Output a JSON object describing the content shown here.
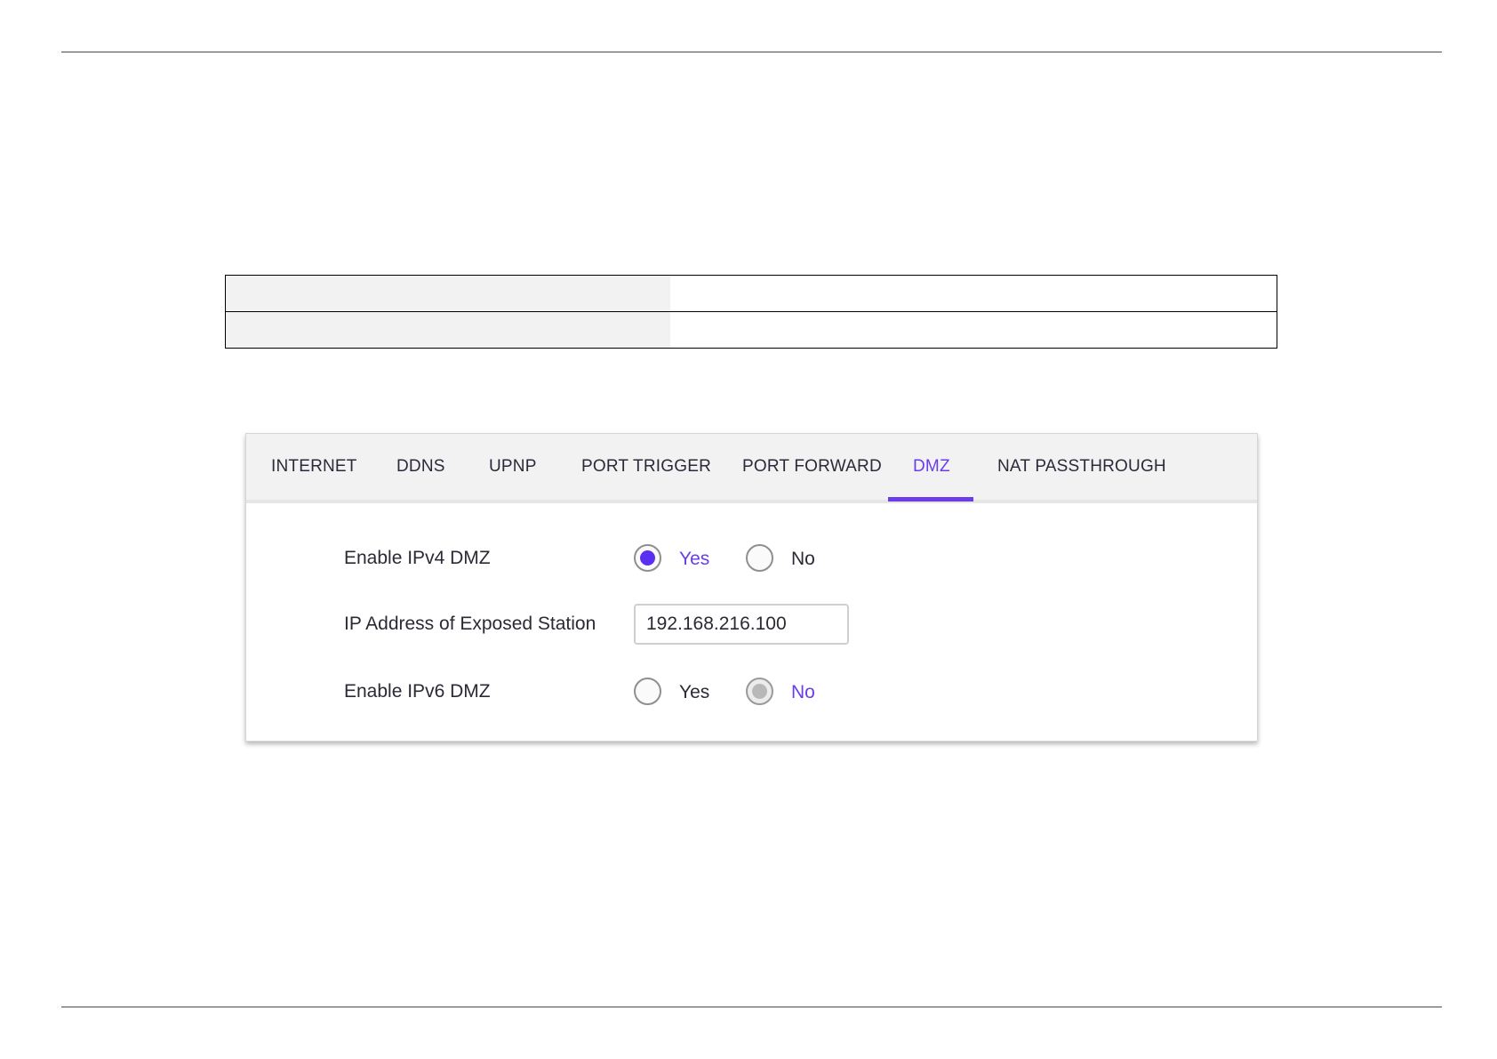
{
  "tabs": [
    {
      "label": "INTERNET",
      "active": false
    },
    {
      "label": "DDNS",
      "active": false
    },
    {
      "label": "UPNP",
      "active": false
    },
    {
      "label": "PORT TRIGGER",
      "active": false
    },
    {
      "label": "PORT FORWARD",
      "active": false
    },
    {
      "label": "DMZ",
      "active": true
    },
    {
      "label": "NAT PASSTHROUGH",
      "active": false
    }
  ],
  "accent_color": "#6a3de8",
  "form": {
    "ipv4_dmz": {
      "label": "Enable IPv4 DMZ",
      "yes_label": "Yes",
      "no_label": "No",
      "selected": "Yes"
    },
    "exposed_station": {
      "label": "IP Address of Exposed Station",
      "value": "192.168.216.100"
    },
    "ipv6_dmz": {
      "label": "Enable IPv6 DMZ",
      "yes_label": "Yes",
      "no_label": "No",
      "selected": "No"
    }
  }
}
